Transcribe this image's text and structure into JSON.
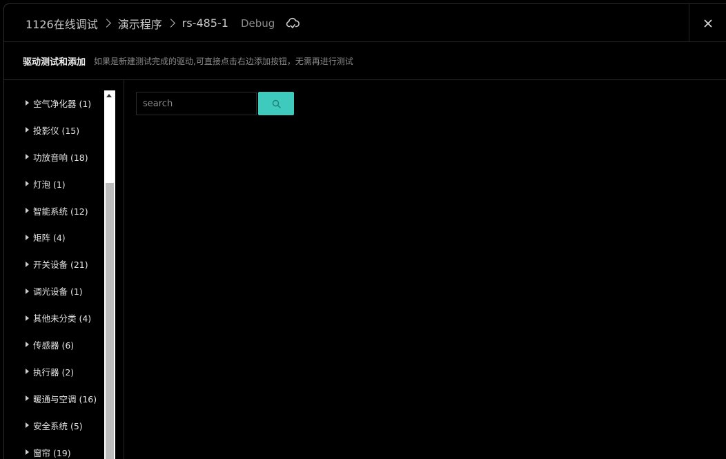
{
  "header": {
    "breadcrumb": [
      "1126在线调试",
      "演示程序",
      "rs-485-1"
    ],
    "mode": "Debug",
    "status_icon": "cloud-sync-icon",
    "close_icon": "close-icon"
  },
  "subheader": {
    "title": "驱动测试和添加",
    "description": "如果是新建测试完成的驱动,可直接点击右边添加按钮，无需再进行测试"
  },
  "sidebar": {
    "items": [
      {
        "label": "空气净化器 (1)"
      },
      {
        "label": "投影仪 (15)"
      },
      {
        "label": "功放音响 (18)"
      },
      {
        "label": "灯泡 (1)"
      },
      {
        "label": "智能系统 (12)"
      },
      {
        "label": "矩阵 (4)"
      },
      {
        "label": "开关设备 (21)"
      },
      {
        "label": "调光设备 (1)"
      },
      {
        "label": "其他未分类 (4)"
      },
      {
        "label": "传感器 (6)"
      },
      {
        "label": "执行器 (2)"
      },
      {
        "label": "暖通与空调 (16)"
      },
      {
        "label": "安全系统 (5)"
      },
      {
        "label": "窗帘 (19)"
      }
    ]
  },
  "search": {
    "placeholder": "search",
    "value": "",
    "button_icon": "search-icon"
  },
  "colors": {
    "accent": "#3ecbbd",
    "background": "#000000",
    "border": "#262626"
  }
}
